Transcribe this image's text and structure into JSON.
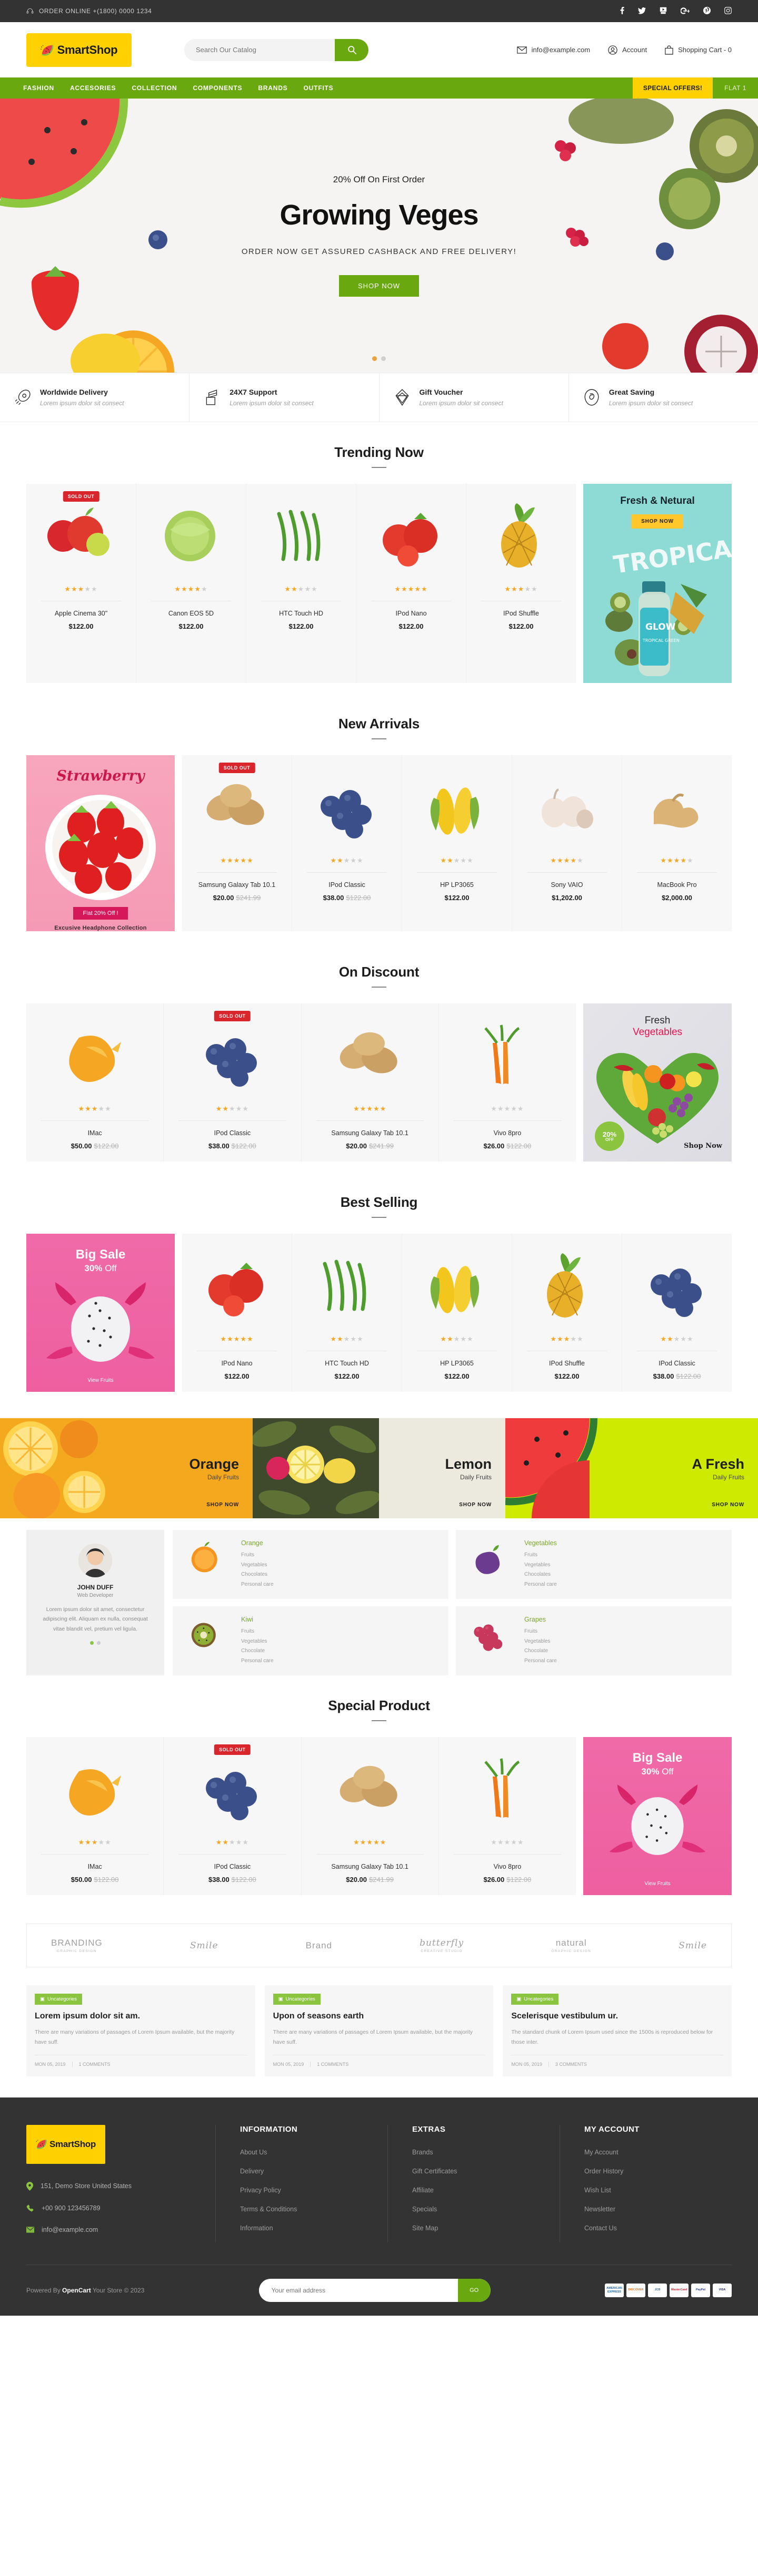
{
  "topbar": {
    "phone": "ORDER ONLINE +(1800) 0000 1234",
    "social": [
      {
        "name": "facebook-icon",
        "glyph": "f"
      },
      {
        "name": "twitter-icon",
        "glyph": "✈"
      },
      {
        "name": "youtube-icon",
        "glyph": "▶"
      },
      {
        "name": "googleplus-icon",
        "glyph": "G+"
      },
      {
        "name": "pinterest-icon",
        "glyph": "P"
      },
      {
        "name": "instagram-icon",
        "glyph": "◎"
      }
    ]
  },
  "header": {
    "logo": "SmartShop",
    "search_placeholder": "Search Our Catalog",
    "search_value": "",
    "email": "info@example.com",
    "account": "Account",
    "cart": "Shopping Cart - 0"
  },
  "nav": {
    "links": [
      "FASHION",
      "ACCESORIES",
      "COLLECTION",
      "COMPONENTS",
      "BRANDS",
      "OUTFITS"
    ],
    "offer_badge": "SPECIAL OFFERS!",
    "offer_text": "FLAT 1"
  },
  "hero": {
    "kicker": "20% Off On First Order",
    "title": "Growing Veges",
    "subtitle": "ORDER NOW GET ASSURED CASHBACK AND FREE DELIVERY!",
    "button": "SHOP NOW",
    "slides": 2,
    "active_slide": 1
  },
  "services": [
    {
      "icon": "rocket-icon",
      "title": "Worldwide Delivery",
      "desc": "Lorem ipsum dolor sit consect"
    },
    {
      "icon": "support-icon",
      "title": "24X7 Support",
      "desc": "Lorem ipsum dolor sit consect"
    },
    {
      "icon": "gift-icon",
      "title": "Gift Voucher",
      "desc": "Lorem ipsum dolor sit consect"
    },
    {
      "icon": "saving-icon",
      "title": "Great Saving",
      "desc": "Lorem ipsum dolor sit consect"
    }
  ],
  "sections": {
    "trending": "Trending Now",
    "new_arrivals": "New Arrivals",
    "on_discount": "On Discount",
    "best_selling": "Best Selling",
    "special_product": "Special Product"
  },
  "trending_products": [
    {
      "name": "Apple Cinema 30\"",
      "price": "$122.00",
      "old_price": "",
      "rating": 3,
      "badge": "SOLD OUT",
      "img": "apples"
    },
    {
      "name": "Canon EOS 5D",
      "price": "$122.00",
      "old_price": "",
      "rating": 4,
      "badge": "",
      "img": "cabbage"
    },
    {
      "name": "HTC Touch HD",
      "price": "$122.00",
      "old_price": "",
      "rating": 2,
      "badge": "",
      "img": "beans"
    },
    {
      "name": "IPod Nano",
      "price": "$122.00",
      "old_price": "",
      "rating": 5,
      "badge": "",
      "img": "tomato"
    },
    {
      "name": "IPod Shuffle",
      "price": "$122.00",
      "old_price": "",
      "rating": 3,
      "badge": "",
      "img": "pineapple"
    }
  ],
  "banner_fresh": {
    "title": "Fresh & Netural",
    "button": "SHOP NOW"
  },
  "banner_strawberry": {
    "title": "Strawberry",
    "badge": "Flat 20% Off !",
    "subtitle": "Excusive Headphone Collection"
  },
  "new_arrival_products": [
    {
      "name": "Samsung Galaxy Tab 10.1",
      "price": "$20.00",
      "old_price": "$241.99",
      "rating": 5,
      "badge": "SOLD OUT",
      "img": "potato"
    },
    {
      "name": "IPod Classic",
      "price": "$38.00",
      "old_price": "$122.00",
      "rating": 2,
      "badge": "",
      "img": "blueberry"
    },
    {
      "name": "HP LP3065",
      "price": "$122.00",
      "old_price": "",
      "rating": 2,
      "badge": "",
      "img": "corn"
    },
    {
      "name": "Sony VAIO",
      "price": "$1,202.00",
      "old_price": "",
      "rating": 4,
      "badge": "",
      "img": "garlic"
    },
    {
      "name": "MacBook Pro",
      "price": "$2,000.00",
      "old_price": "",
      "rating": 4,
      "badge": "",
      "img": "ginger"
    }
  ],
  "discount_products": [
    {
      "name": "IMac",
      "price": "$50.00",
      "old_price": "$122.00",
      "rating": 3,
      "badge": "",
      "img": "mango"
    },
    {
      "name": "IPod Classic",
      "price": "$38.00",
      "old_price": "$122.00",
      "rating": 2,
      "badge": "SOLD OUT",
      "img": "blueberry"
    },
    {
      "name": "Samsung Galaxy Tab 10.1",
      "price": "$20.00",
      "old_price": "$241.99",
      "rating": 5,
      "badge": "",
      "img": "potato"
    },
    {
      "name": "Vivo 8pro",
      "price": "$26.00",
      "old_price": "$122.00",
      "rating": 0,
      "badge": "",
      "img": "carrot"
    }
  ],
  "banner_vegetables": {
    "line1": "Fresh",
    "line2": "Vegetables",
    "badge": "20%",
    "badge_sub": "OFF",
    "link": "Shop Now"
  },
  "best_selling_products": [
    {
      "name": "IPod Nano",
      "price": "$122.00",
      "old_price": "",
      "rating": 5,
      "badge": "",
      "img": "tomato"
    },
    {
      "name": "HTC Touch HD",
      "price": "$122.00",
      "old_price": "",
      "rating": 2,
      "badge": "",
      "img": "beans"
    },
    {
      "name": "HP LP3065",
      "price": "$122.00",
      "old_price": "",
      "rating": 2,
      "badge": "",
      "img": "corn"
    },
    {
      "name": "IPod Shuffle",
      "price": "$122.00",
      "old_price": "",
      "rating": 3,
      "badge": "",
      "img": "pineapple"
    },
    {
      "name": "IPod Classic",
      "price": "$38.00",
      "old_price": "$122.00",
      "rating": 2,
      "badge": "",
      "img": "blueberry"
    }
  ],
  "banner_bigsale": {
    "title": "Big Sale",
    "subtitle_num": "30%",
    "subtitle_txt": "Off",
    "link": "View Fruits"
  },
  "category_strip": [
    {
      "title": "Orange",
      "subtitle": "Daily Fruits",
      "link": "SHOP NOW",
      "color": "#f5a623"
    },
    {
      "title": "Lemon",
      "subtitle": "Daily Fruits",
      "link": "SHOP NOW",
      "color": "#e8e8e0"
    },
    {
      "title": "A Fresh",
      "subtitle": "Daily Fruits",
      "link": "SHOP NOW",
      "color": "#c6e000"
    }
  ],
  "testimonial": {
    "name": "JOHN DUFF",
    "role": "Web Developer",
    "text": "Lorem ipsum dolor sit amet, consectetur adipiscing elit. Aliquam ex nulla, consequat vitae blandit vel, pretium vel ligula.",
    "dots": 2,
    "active_dot": 0
  },
  "category_boxes": [
    {
      "title": "Orange",
      "img": "orange",
      "items": [
        "Fruits",
        "Vegetables",
        "Chocolates",
        "Personal care"
      ]
    },
    {
      "title": "Vegetables",
      "img": "eggplant",
      "items": [
        "Fruits",
        "Vegetables",
        "Chocolates",
        "Personal care"
      ]
    },
    {
      "title": "Kiwi",
      "img": "kiwi",
      "items": [
        "Fruits",
        "Vegetables",
        "Chocolate",
        "Personal care"
      ]
    },
    {
      "title": "Grapes",
      "img": "grapes",
      "items": [
        "Fruits",
        "Vegetables",
        "Chocolate",
        "Personal care"
      ]
    }
  ],
  "special_products": [
    {
      "name": "IMac",
      "price": "$50.00",
      "old_price": "$122.00",
      "rating": 3,
      "badge": "",
      "img": "mango"
    },
    {
      "name": "IPod Classic",
      "price": "$38.00",
      "old_price": "$122.00",
      "rating": 2,
      "badge": "SOLD OUT",
      "img": "blueberry"
    },
    {
      "name": "Samsung Galaxy Tab 10.1",
      "price": "$20.00",
      "old_price": "$241.99",
      "rating": 5,
      "badge": "",
      "img": "potato"
    },
    {
      "name": "Vivo 8pro",
      "price": "$26.00",
      "old_price": "$122.00",
      "rating": 0,
      "badge": "",
      "img": "carrot"
    }
  ],
  "brands": [
    {
      "name": "BRANDING",
      "sub": "GRAPHIC DESIGN",
      "style": "plain"
    },
    {
      "name": "Smile",
      "sub": "",
      "style": "script"
    },
    {
      "name": "Brand",
      "sub": "",
      "style": "plain"
    },
    {
      "name": "butterfly",
      "sub": "CREATIVE STUDIO",
      "style": "script"
    },
    {
      "name": "natural",
      "sub": "GRAPHIC DESIGN",
      "style": "plain"
    },
    {
      "name": "Smile",
      "sub": "",
      "style": "script"
    }
  ],
  "blog_posts": [
    {
      "tag": "Uncategories",
      "title": "Lorem ipsum dolor sit am.",
      "text": "There are many variations of passages of Lorem Ipsum available, but the majority have suff.",
      "date": "MON 05, 2019",
      "comments": "1 COMMENTS"
    },
    {
      "tag": "Uncategories",
      "title": "Upon of seasons earth",
      "text": "There are many variations of passages of Lorem Ipsum available, but the majority have suff.",
      "date": "MON 05, 2019",
      "comments": "1 COMMENTS"
    },
    {
      "tag": "Uncategories",
      "title": "Scelerisque vestibulum ur.",
      "text": "The standard chunk of Lorem Ipsum used since the 1500s is reproduced below for those inter.",
      "date": "MON 05, 2019",
      "comments": "3 COMMENTS"
    }
  ],
  "footer": {
    "logo": "SmartShop",
    "address": "151, Demo Store United States",
    "phone": "+00 900 123456789",
    "email": "info@example.com",
    "columns": [
      {
        "title": "INFORMATION",
        "links": [
          "About Us",
          "Delivery",
          "Privacy Policy",
          "Terms & Conditions",
          "Information"
        ]
      },
      {
        "title": "EXTRAS",
        "links": [
          "Brands",
          "Gift Certificates",
          "Affiliate",
          "Specials",
          "Site Map"
        ]
      },
      {
        "title": "MY ACCOUNT",
        "links": [
          "My Account",
          "Order History",
          "Wish List",
          "Newsletter",
          "Contact Us"
        ]
      }
    ],
    "copyright_prefix": "Powered By ",
    "copyright_brand": "OpenCart",
    "copyright_suffix": " Your Store © 2023",
    "newsletter_placeholder": "Your email address",
    "newsletter_button": "GO",
    "cards": [
      "AMERICAN EXPRESS",
      "DISCOVER",
      "JCB",
      "MasterCard",
      "PayPal",
      "VISA"
    ]
  },
  "colors": {
    "green": "#6aa80f",
    "yellow": "#ffd100",
    "dark": "#333333",
    "red": "#d9262c",
    "pink": "#ee5fa0",
    "star": "#f5a623"
  }
}
